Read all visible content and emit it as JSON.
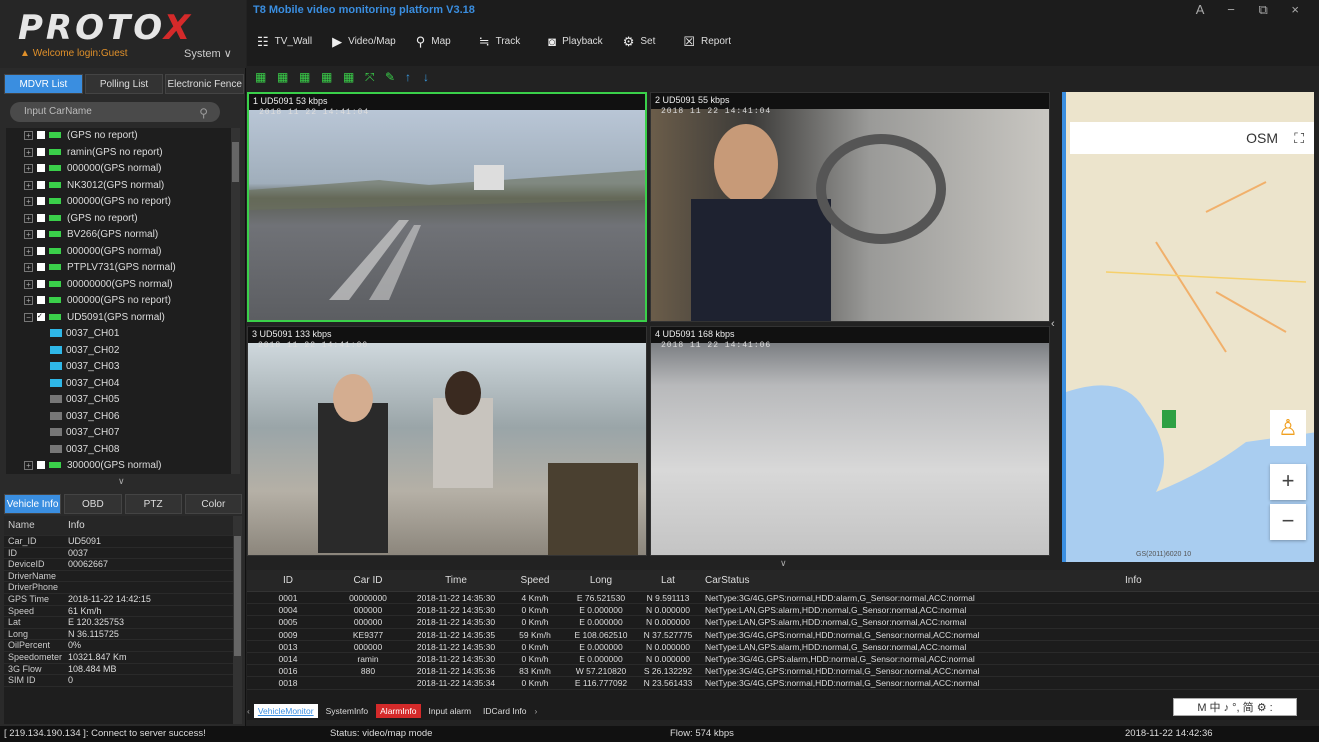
{
  "app": {
    "logo": "PROTOX",
    "title": "T8 Mobile video monitoring platform V3.18",
    "welcome": "Welcome login:Guest",
    "system": "System",
    "window_controls": "A − ⧉ ×"
  },
  "left_tabs": [
    "MDVR List",
    "Polling List",
    "Electronic Fence"
  ],
  "search": {
    "placeholder": "Input CarName"
  },
  "tree": [
    {
      "label": "(GPS no report)",
      "type": "car"
    },
    {
      "label": "ramin(GPS no report)",
      "type": "car"
    },
    {
      "label": "000000(GPS normal)",
      "type": "car"
    },
    {
      "label": "NK3012(GPS normal)",
      "type": "car"
    },
    {
      "label": "000000(GPS no report)",
      "type": "car"
    },
    {
      "label": "(GPS no report)",
      "type": "car"
    },
    {
      "label": "BV266(GPS normal)",
      "type": "car"
    },
    {
      "label": "000000(GPS normal)",
      "type": "car"
    },
    {
      "label": "PTPLV731(GPS normal)",
      "type": "car"
    },
    {
      "label": "00000000(GPS normal)",
      "type": "car"
    },
    {
      "label": "000000(GPS no report)",
      "type": "car"
    },
    {
      "label": "UD5091(GPS normal)",
      "type": "car-open"
    },
    {
      "label": "0037_CH01",
      "type": "ch-on"
    },
    {
      "label": "0037_CH02",
      "type": "ch-on"
    },
    {
      "label": "0037_CH03",
      "type": "ch-on"
    },
    {
      "label": "0037_CH04",
      "type": "ch-on"
    },
    {
      "label": "0037_CH05",
      "type": "ch-off"
    },
    {
      "label": "0037_CH06",
      "type": "ch-off"
    },
    {
      "label": "0037_CH07",
      "type": "ch-off"
    },
    {
      "label": "0037_CH08",
      "type": "ch-off"
    },
    {
      "label": "300000(GPS normal)",
      "type": "car"
    }
  ],
  "info_tabs": [
    "Vehicle Info",
    "OBD",
    "PTZ",
    "Color"
  ],
  "vehicle_info": {
    "header": [
      "Name",
      "Info"
    ],
    "rows": [
      [
        "Car_ID",
        "UD5091"
      ],
      [
        "ID",
        "0037"
      ],
      [
        "DeviceID",
        "00062667"
      ],
      [
        "DriverName",
        ""
      ],
      [
        "DriverPhone",
        ""
      ],
      [
        "GPS Time",
        "2018-11-22 14:42:15"
      ],
      [
        "Speed",
        "61 Km/h"
      ],
      [
        "Lat",
        "E 120.325753"
      ],
      [
        "Long",
        "N 36.115725"
      ],
      [
        "OilPercent",
        "0%"
      ],
      [
        "Speedometer",
        "10321.847 Km"
      ],
      [
        "3G Flow",
        "108.484 MB"
      ],
      [
        "SIM ID",
        "0"
      ]
    ]
  },
  "menu": [
    "TV_Wall",
    "Video/Map",
    "Map",
    "Track",
    "Playback",
    "Set",
    "Report"
  ],
  "videos": [
    {
      "title": "1   UD5091  53 kbps",
      "time": "2018 11 22 14:41:04"
    },
    {
      "title": "2   UD5091  55 kbps",
      "time": "2018 11 22 14:41:04"
    },
    {
      "title": "3   UD5091  133 kbps",
      "time": "2018 11 22 14:41:00"
    },
    {
      "title": "4   UD5091  168 kbps",
      "time": "2018 11 22 14:41:06"
    }
  ],
  "map": {
    "label": "OSM",
    "zoom_in": "+",
    "zoom_out": "−",
    "footer": "GS(2011)6020  10"
  },
  "table": {
    "headers": [
      "ID",
      "Car ID",
      "Time",
      "Speed",
      "Long",
      "Lat",
      "CarStatus",
      "Info"
    ],
    "rows": [
      [
        "0001",
        "00000000",
        "2018-11-22 14:35:30",
        "4 Km/h",
        "E 76.521530",
        "N 9.591113",
        "NetType:3G/4G,GPS:normal,HDD:alarm,G_Sensor:normal,ACC:normal",
        ""
      ],
      [
        "0004",
        "000000",
        "2018-11-22 14:35:30",
        "0 Km/h",
        "E 0.000000",
        "N 0.000000",
        "NetType:LAN,GPS:alarm,HDD:normal,G_Sensor:normal,ACC:normal",
        ""
      ],
      [
        "0005",
        "000000",
        "2018-11-22 14:35:30",
        "0 Km/h",
        "E 0.000000",
        "N 0.000000",
        "NetType:LAN,GPS:alarm,HDD:normal,G_Sensor:normal,ACC:normal",
        ""
      ],
      [
        "0009",
        "KE9377",
        "2018-11-22 14:35:35",
        "59 Km/h",
        "E 108.062510",
        "N 37.527775",
        "NetType:3G/4G,GPS:normal,HDD:normal,G_Sensor:normal,ACC:normal",
        ""
      ],
      [
        "0013",
        "000000",
        "2018-11-22 14:35:30",
        "0 Km/h",
        "E 0.000000",
        "N 0.000000",
        "NetType:LAN,GPS:alarm,HDD:normal,G_Sensor:normal,ACC:normal",
        ""
      ],
      [
        "0014",
        "ramin",
        "2018-11-22 14:35:30",
        "0 Km/h",
        "E 0.000000",
        "N 0.000000",
        "NetType:3G/4G,GPS:alarm,HDD:normal,G_Sensor:normal,ACC:normal",
        ""
      ],
      [
        "0016",
        "880",
        "2018-11-22 14:35:36",
        "83 Km/h",
        "W 57.210820",
        "S 26.132292",
        "NetType:3G/4G,GPS:normal,HDD:normal,G_Sensor:normal,ACC:normal",
        ""
      ],
      [
        "0018",
        "",
        "2018-11-22 14:35:34",
        "0 Km/h",
        "E 116.777092",
        "N 23.561433",
        "NetType:3G/4G,GPS:normal,HDD:normal,G_Sensor:normal,ACC:normal",
        ""
      ]
    ]
  },
  "bottom_tabs": [
    "VehicleMonitor",
    "SystemInfo",
    "AlarmInfo",
    "Input alarm",
    "IDCard Info"
  ],
  "ime": "M 中 ♪ °, 简 ⚙ :",
  "status": {
    "connection": "[ 219.134.190.134 ]: Connect to server success!",
    "mode": "Status: video/map mode",
    "flow": "Flow: 574 kbps",
    "datetime": "2018-11-22 14:42:36"
  },
  "colors": {
    "accent": "#3a8ee0",
    "green": "#3ad04a",
    "alarm": "#d42a2a",
    "logo_accent": "#d42a2a"
  }
}
